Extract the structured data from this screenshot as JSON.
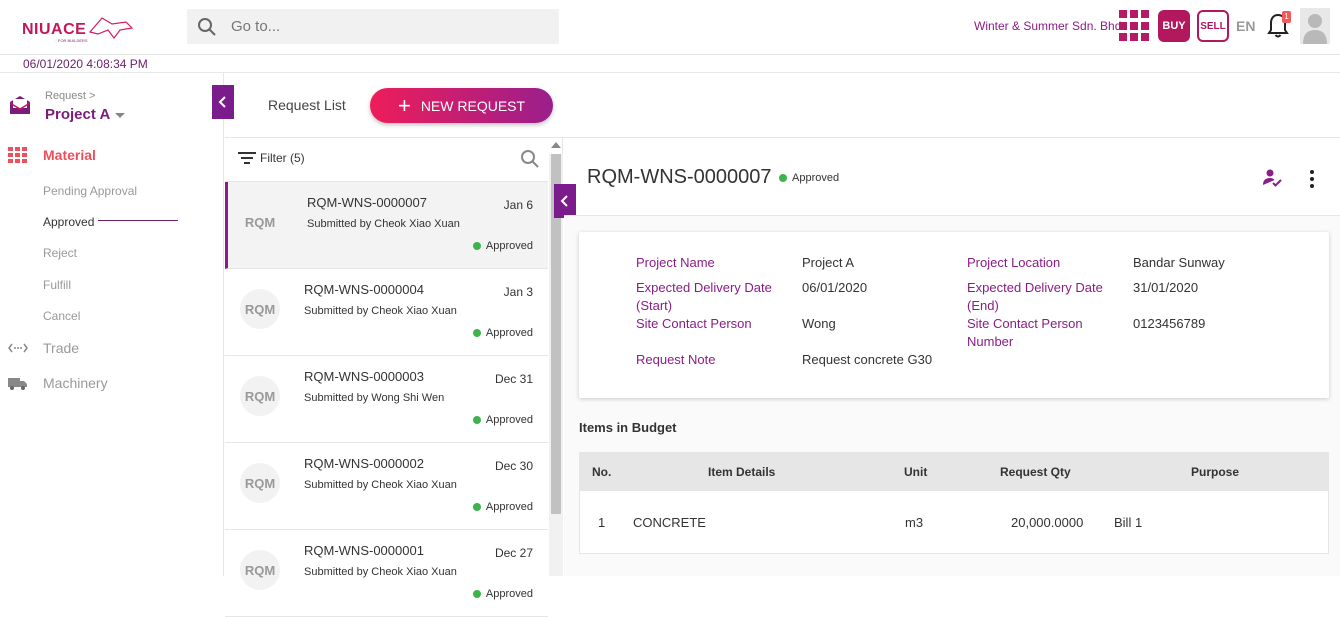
{
  "header": {
    "logo_text": "NIUACE",
    "logo_tagline": "FOR BUILDERS",
    "search_placeholder": "Go to...",
    "company": "Winter & Summer Sdn. Bhd.",
    "buy_label": "BUY",
    "sell_label": "SELL",
    "language": "EN",
    "notification_count": "1",
    "datetime": "06/01/2020 4:08:34 PM"
  },
  "sidebar": {
    "breadcrumb": "Request >",
    "project": "Project A",
    "sections": [
      {
        "label": "Material",
        "icon": "grid-icon"
      },
      {
        "label": "Trade",
        "icon": "arrows-icon"
      },
      {
        "label": "Machinery",
        "icon": "truck-icon"
      }
    ],
    "material_items": [
      "Pending Approval",
      "Approved",
      "Reject",
      "Fulfill",
      "Cancel"
    ],
    "active_item": "Approved"
  },
  "toolbar": {
    "request_list_label": "Request List",
    "new_request_label": "NEW REQUEST"
  },
  "list": {
    "filter_label": "Filter (5)",
    "items": [
      {
        "avatar": "RQM",
        "id": "RQM-WNS-0000007",
        "submitted_by": "Submitted by Cheok Xiao Xuan",
        "date": "Jan 6",
        "status": "Approved"
      },
      {
        "avatar": "RQM",
        "id": "RQM-WNS-0000004",
        "submitted_by": "Submitted by Cheok Xiao Xuan",
        "date": "Jan 3",
        "status": "Approved"
      },
      {
        "avatar": "RQM",
        "id": "RQM-WNS-0000003",
        "submitted_by": "Submitted by Wong Shi Wen",
        "date": "Dec 31",
        "status": "Approved"
      },
      {
        "avatar": "RQM",
        "id": "RQM-WNS-0000002",
        "submitted_by": "Submitted by Cheok Xiao Xuan",
        "date": "Dec 30",
        "status": "Approved"
      },
      {
        "avatar": "RQM",
        "id": "RQM-WNS-0000001",
        "submitted_by": "Submitted by Cheok Xiao Xuan",
        "date": "Dec 27",
        "status": "Approved"
      }
    ]
  },
  "detail": {
    "title": "RQM-WNS-0000007",
    "status": "Approved",
    "fields": {
      "project_name_label": "Project Name",
      "project_name": "Project A",
      "project_location_label": "Project Location",
      "project_location": "Bandar Sunway",
      "delivery_start_label_1": "Expected Delivery Date",
      "delivery_start_label_2": "(Start)",
      "delivery_start": "06/01/2020",
      "delivery_end_label_1": "Expected Delivery Date",
      "delivery_end_label_2": "(End)",
      "delivery_end": "31/01/2020",
      "site_contact_label": "Site Contact Person",
      "site_contact": "Wong",
      "site_contact_number_label_1": "Site Contact Person",
      "site_contact_number_label_2": "Number",
      "site_contact_number": "0123456789",
      "request_note_label": "Request Note",
      "request_note": "Request concrete G30"
    },
    "budget_title": "Items in Budget",
    "table": {
      "headers": [
        "No.",
        "Item Details",
        "Unit",
        "Request Qty",
        "Purpose"
      ],
      "rows": [
        {
          "no": "1",
          "item": "CONCRETE",
          "unit": "m3",
          "qty": "20,000.0000",
          "purpose": "Bill 1"
        }
      ]
    }
  },
  "colors": {
    "brand_purple": "#7b1c8c",
    "brand_red": "#ee1d5b",
    "status_green": "#3cb44b"
  }
}
